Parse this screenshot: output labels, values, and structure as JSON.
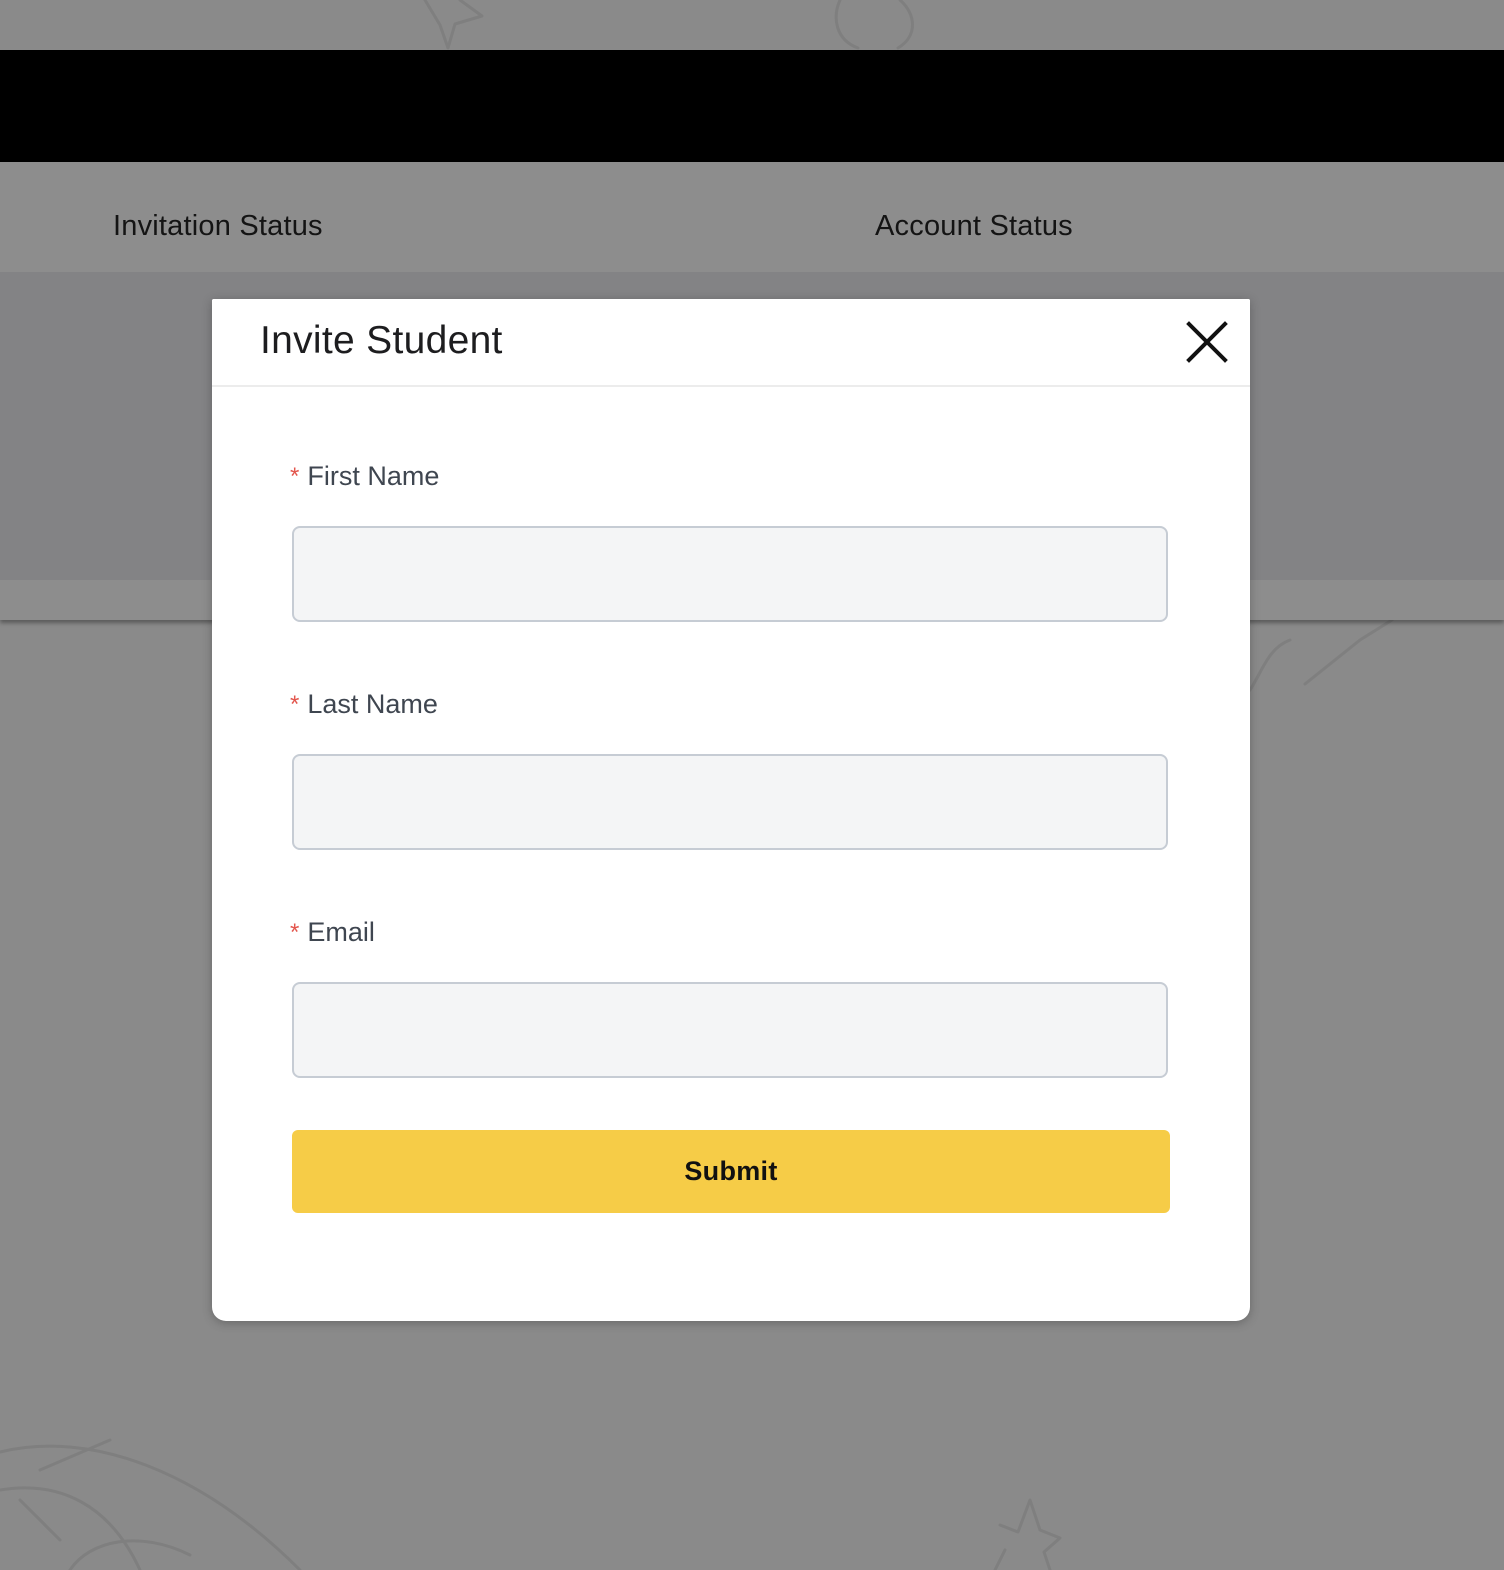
{
  "table": {
    "columns": [
      "Invitation Status",
      "Account Status"
    ]
  },
  "modal": {
    "title": "Invite Student",
    "close_icon": "close-icon",
    "required_marker": "*",
    "fields": [
      {
        "label": "First Name",
        "value": "",
        "placeholder": ""
      },
      {
        "label": "Last Name",
        "value": "",
        "placeholder": ""
      },
      {
        "label": "Email",
        "value": "",
        "placeholder": ""
      }
    ],
    "submit_label": "Submit"
  },
  "colors": {
    "overlay": "#8a8a8a",
    "topbar": "#000000",
    "submit": "#f6cc47",
    "required": "#e3564d",
    "input_bg": "#f4f5f6",
    "input_border": "#c6ccd4"
  }
}
